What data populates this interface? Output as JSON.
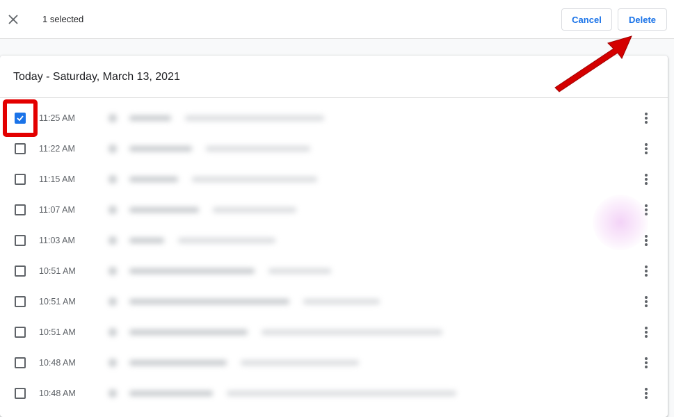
{
  "toolbar": {
    "close_icon": "close-icon",
    "selected_text": "1 selected",
    "cancel_label": "Cancel",
    "delete_label": "Delete"
  },
  "history": {
    "date_heading": "Today - Saturday, March 13, 2021",
    "entries": [
      {
        "time": "11:25 AM",
        "checked": true,
        "blurred": true
      },
      {
        "time": "11:22 AM",
        "checked": false,
        "blurred": true
      },
      {
        "time": "11:15 AM",
        "checked": false,
        "blurred": true
      },
      {
        "time": "11:07 AM",
        "checked": false,
        "blurred": true
      },
      {
        "time": "11:03 AM",
        "checked": false,
        "blurred": true
      },
      {
        "time": "10:51 AM",
        "checked": false,
        "blurred": true
      },
      {
        "time": "10:51 AM",
        "checked": false,
        "blurred": true
      },
      {
        "time": "10:51 AM",
        "checked": false,
        "blurred": true
      },
      {
        "time": "10:48 AM",
        "checked": false,
        "blurred": true
      },
      {
        "time": "10:48 AM",
        "checked": false,
        "blurred": true
      }
    ]
  },
  "annotations": {
    "highlight_color": "#e30000",
    "arrow_color": "#d40000",
    "arrow_target": "delete-button"
  },
  "colors": {
    "accent": "#1a73e8"
  }
}
